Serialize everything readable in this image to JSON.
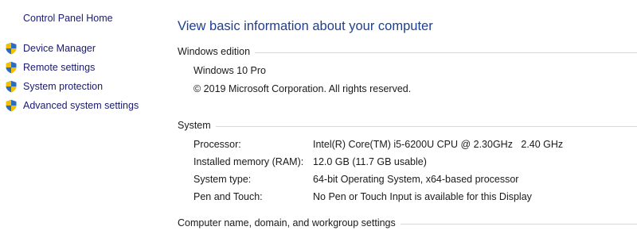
{
  "nav": {
    "home": "Control Panel Home",
    "links": [
      {
        "label": "Device Manager",
        "icon": "uac-shield-icon"
      },
      {
        "label": "Remote settings",
        "icon": "uac-shield-icon"
      },
      {
        "label": "System protection",
        "icon": "uac-shield-icon"
      },
      {
        "label": "Advanced system settings",
        "icon": "uac-shield-icon"
      }
    ]
  },
  "main": {
    "title": "View basic information about your computer",
    "windows_edition": {
      "header": "Windows edition",
      "edition": "Windows 10 Pro",
      "copyright": "© 2019 Microsoft Corporation. All rights reserved."
    },
    "system": {
      "header": "System",
      "rows": [
        {
          "key": "Processor:",
          "value": "Intel(R) Core(TM) i5-6200U CPU @ 2.30GHz   2.40 GHz"
        },
        {
          "key": "Installed memory (RAM):",
          "value": "12.0 GB (11.7 GB usable)"
        },
        {
          "key": "System type:",
          "value": "64-bit Operating System, x64-based processor"
        },
        {
          "key": "Pen and Touch:",
          "value": "No Pen or Touch Input is available for this Display"
        }
      ]
    },
    "computer_name": {
      "header": "Computer name, domain, and workgroup settings"
    }
  },
  "colors": {
    "link": "#1a1a6e",
    "title": "#1e3f92",
    "divider": "#d9d9d9",
    "shield_blue": "#2d6cc0",
    "shield_yellow": "#f2c200"
  }
}
